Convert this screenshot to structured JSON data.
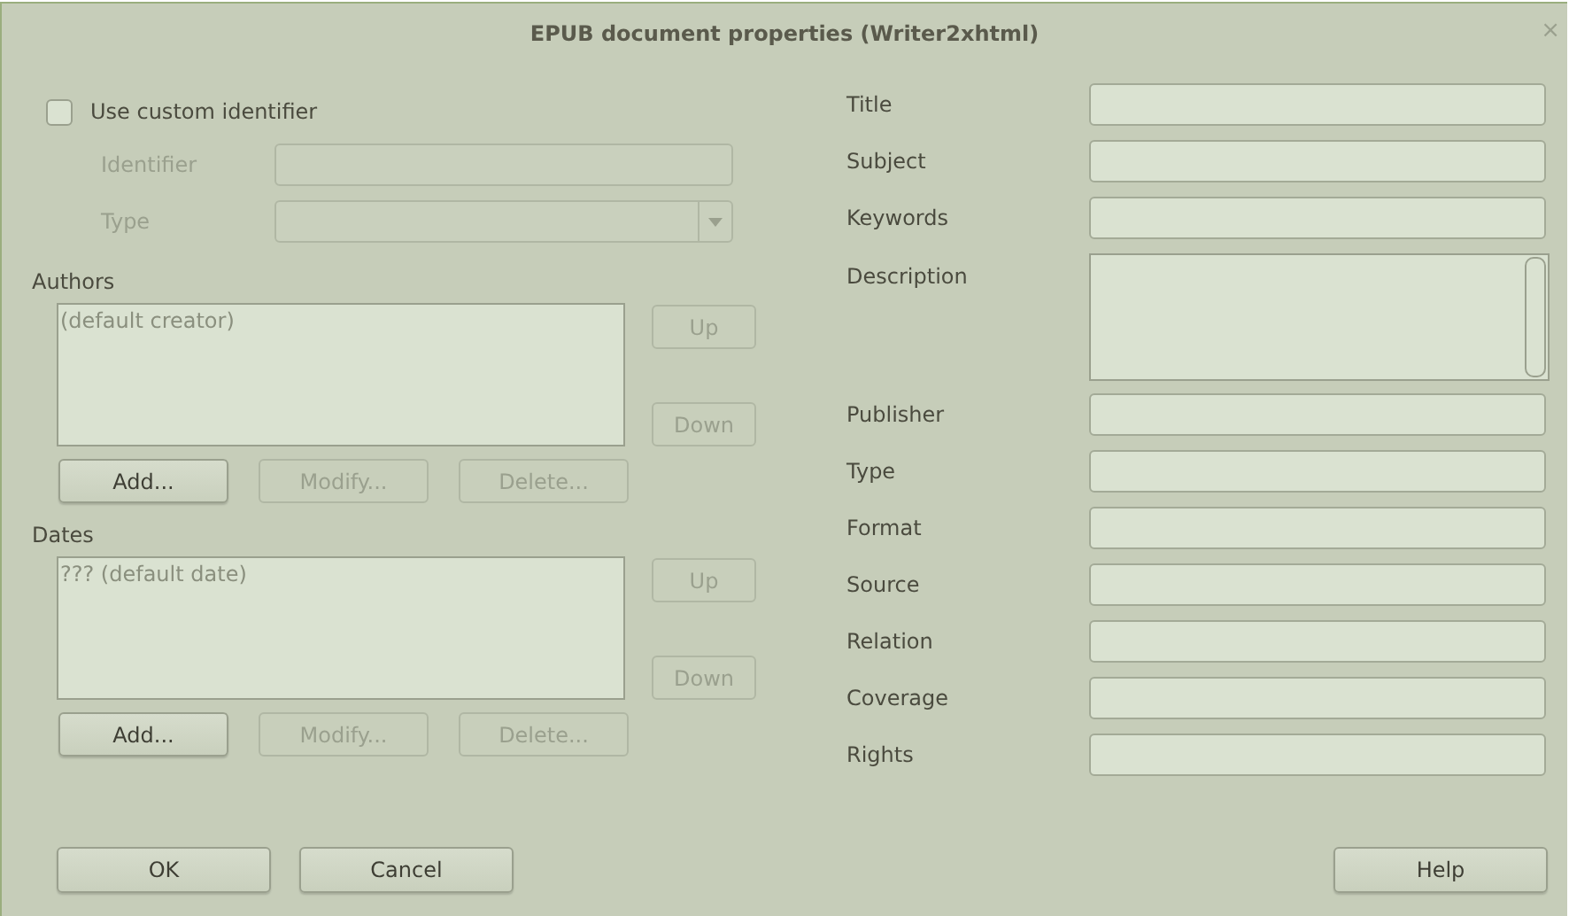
{
  "window": {
    "title": "EPUB document properties (Writer2xhtml)",
    "close": "×"
  },
  "identifier": {
    "checkbox": {
      "label": "Use custom identifier",
      "checked": false
    },
    "fields": [
      {
        "label": "Identifier",
        "kind": "text",
        "disabled": true
      },
      {
        "label": "Type",
        "kind": "dropdown",
        "disabled": true
      }
    ]
  },
  "lists": [
    {
      "label": "Authors",
      "items": [
        "(default creator)"
      ],
      "side_buttons": [
        {
          "label": "Up",
          "disabled": true
        },
        {
          "label": "Down",
          "disabled": true
        }
      ],
      "buttons": [
        {
          "label": "Add...",
          "disabled": false
        },
        {
          "label": "Modify...",
          "disabled": true
        },
        {
          "label": "Delete...",
          "disabled": true
        }
      ]
    },
    {
      "label": "Dates",
      "items": [
        "??? (default date)"
      ],
      "side_buttons": [
        {
          "label": "Up",
          "disabled": true
        },
        {
          "label": "Down",
          "disabled": true
        }
      ],
      "buttons": [
        {
          "label": "Add...",
          "disabled": false
        },
        {
          "label": "Modify...",
          "disabled": true
        },
        {
          "label": "Delete...",
          "disabled": true
        }
      ]
    }
  ],
  "properties": [
    {
      "label": "Title",
      "kind": "text"
    },
    {
      "label": "Subject",
      "kind": "text"
    },
    {
      "label": "Keywords",
      "kind": "text"
    },
    {
      "label": "Description",
      "kind": "multiline"
    },
    {
      "label": "Publisher",
      "kind": "text"
    },
    {
      "label": "Type",
      "kind": "text"
    },
    {
      "label": "Format",
      "kind": "text"
    },
    {
      "label": "Source",
      "kind": "text"
    },
    {
      "label": "Relation",
      "kind": "text"
    },
    {
      "label": "Coverage",
      "kind": "text"
    },
    {
      "label": "Rights",
      "kind": "text"
    }
  ],
  "footer": {
    "left_buttons": [
      "OK",
      "Cancel"
    ],
    "right_buttons": [
      "Help"
    ]
  }
}
